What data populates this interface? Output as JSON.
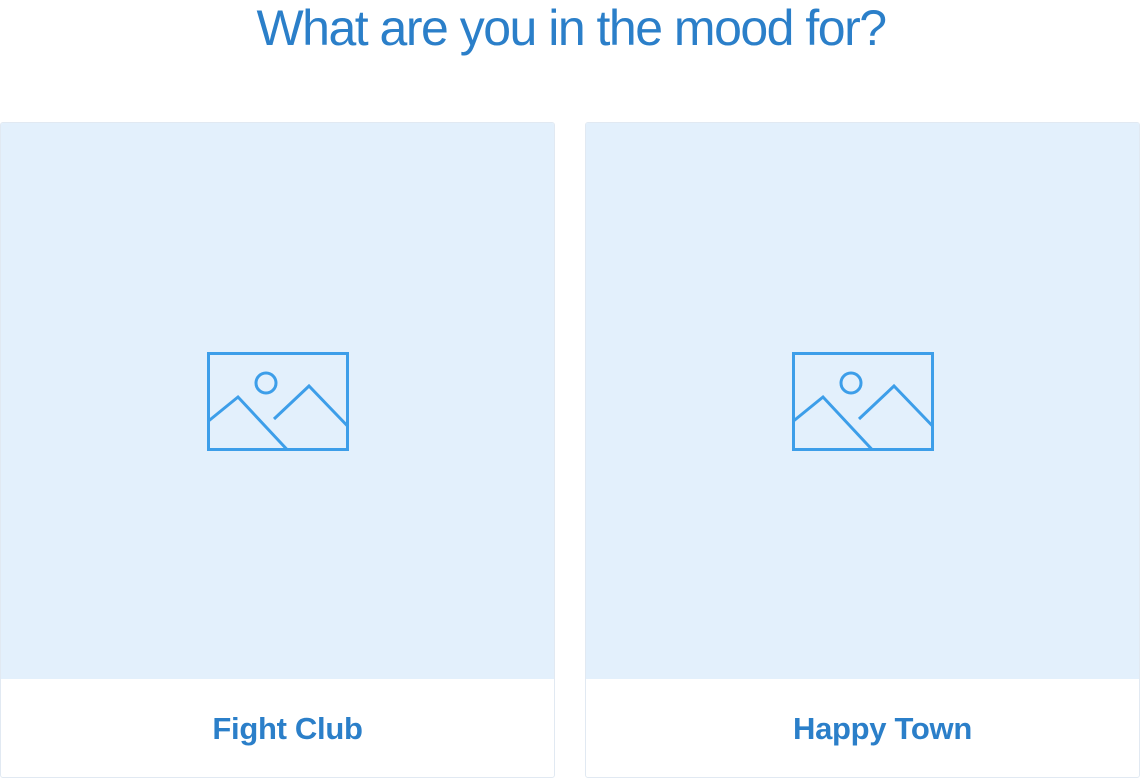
{
  "header": {
    "title": "What are you in the mood for?"
  },
  "options": [
    {
      "label": "Fight Club",
      "image_icon": "image-placeholder-icon"
    },
    {
      "label": "Happy Town",
      "image_icon": "image-placeholder-icon"
    }
  ],
  "colors": {
    "accent": "#2b7fc9",
    "icon_stroke": "#3d9ee9",
    "image_background": "#e3f0fc",
    "card_border": "#e1e9f2"
  }
}
